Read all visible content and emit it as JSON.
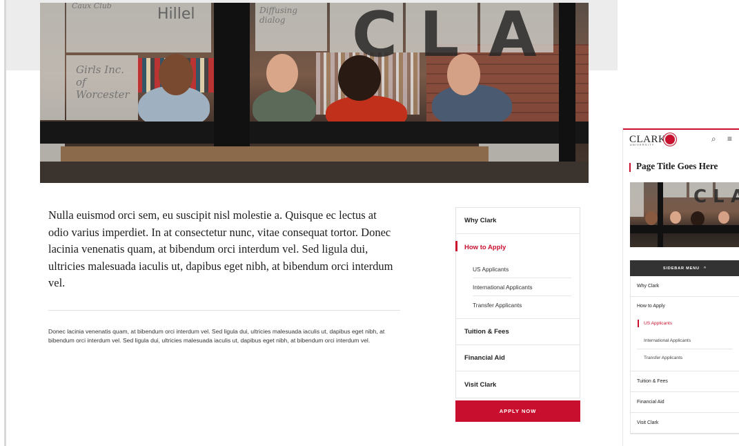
{
  "hero": {
    "signs": {
      "hillel": "Hillel",
      "girls_inc": "Girls Inc. of Worcester",
      "diffusion": "Diffusing dialog",
      "club": "Caux Club"
    },
    "letters": [
      "C",
      "L",
      "A"
    ]
  },
  "main": {
    "lead": "Nulla euismod orci sem, eu suscipit nisl molestie a. Quisque ec lectus at odio varius imperdiet. In at consectetur nunc, vitae consequat tortor. Donec lacinia venenatis quam, at bibendum orci interdum vel. Sed ligula dui, ultricies malesuada iaculis ut, dapibus eget nibh, at bibendum orci interdum vel.",
    "body": "Donec lacinia venenatis quam, at bibendum orci interdum vel. Sed ligula dui, ultricies malesuada iaculis ut, dapibus eget nibh, at bibendum orci interdum vel. Sed ligula dui, ultricies malesuada iaculis ut, dapibus eget nibh, at bibendum orci interdum vel."
  },
  "sidebar": {
    "items": [
      {
        "label": "Why Clark"
      },
      {
        "label": "How to Apply",
        "active": true
      },
      {
        "label": "Tuition & Fees"
      },
      {
        "label": "Financial Aid"
      },
      {
        "label": "Visit Clark"
      }
    ],
    "how_to_apply_sub": [
      {
        "label": "US Applicants"
      },
      {
        "label": "International Applicants"
      },
      {
        "label": "Transfer Applicants"
      }
    ],
    "apply_label": "APPLY NOW"
  },
  "mobile": {
    "logo": "CLARK",
    "logo_sub": "UNIVERSITY",
    "search_icon": "⌕",
    "menu_icon": "≡",
    "page_title": "Page Title Goes Here",
    "photo_letters": [
      "C",
      "L",
      "A"
    ],
    "sidebar_menu_label": "SIDEBAR MENU",
    "sidebar_menu_chevron": "^",
    "items": {
      "why": "Why Clark",
      "how": "How to Apply",
      "us": "US Applicants",
      "intl": "International Applicants",
      "transfer": "Transfer Applicants",
      "tuition": "Tuition & Fees",
      "aid": "Financial Aid",
      "visit": "Visit Clark"
    }
  },
  "colors": {
    "accent": "#c8102e",
    "sidebar_head": "#333333"
  },
  "icons": {
    "search": "search-icon",
    "menu": "hamburger-menu-icon",
    "chevron": "chevron-up-icon"
  }
}
